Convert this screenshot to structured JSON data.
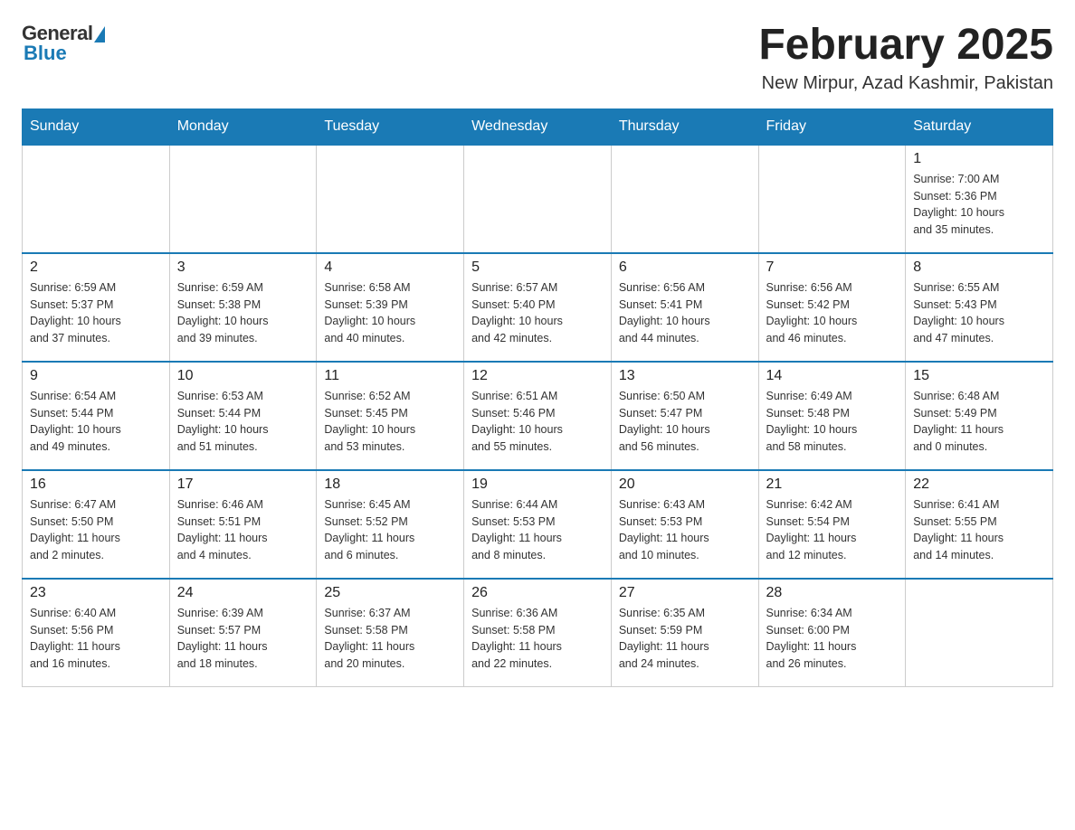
{
  "logo": {
    "general": "General",
    "blue": "Blue"
  },
  "title": "February 2025",
  "subtitle": "New Mirpur, Azad Kashmir, Pakistan",
  "weekdays": [
    "Sunday",
    "Monday",
    "Tuesday",
    "Wednesday",
    "Thursday",
    "Friday",
    "Saturday"
  ],
  "weeks": [
    [
      {
        "day": "",
        "info": ""
      },
      {
        "day": "",
        "info": ""
      },
      {
        "day": "",
        "info": ""
      },
      {
        "day": "",
        "info": ""
      },
      {
        "day": "",
        "info": ""
      },
      {
        "day": "",
        "info": ""
      },
      {
        "day": "1",
        "info": "Sunrise: 7:00 AM\nSunset: 5:36 PM\nDaylight: 10 hours\nand 35 minutes."
      }
    ],
    [
      {
        "day": "2",
        "info": "Sunrise: 6:59 AM\nSunset: 5:37 PM\nDaylight: 10 hours\nand 37 minutes."
      },
      {
        "day": "3",
        "info": "Sunrise: 6:59 AM\nSunset: 5:38 PM\nDaylight: 10 hours\nand 39 minutes."
      },
      {
        "day": "4",
        "info": "Sunrise: 6:58 AM\nSunset: 5:39 PM\nDaylight: 10 hours\nand 40 minutes."
      },
      {
        "day": "5",
        "info": "Sunrise: 6:57 AM\nSunset: 5:40 PM\nDaylight: 10 hours\nand 42 minutes."
      },
      {
        "day": "6",
        "info": "Sunrise: 6:56 AM\nSunset: 5:41 PM\nDaylight: 10 hours\nand 44 minutes."
      },
      {
        "day": "7",
        "info": "Sunrise: 6:56 AM\nSunset: 5:42 PM\nDaylight: 10 hours\nand 46 minutes."
      },
      {
        "day": "8",
        "info": "Sunrise: 6:55 AM\nSunset: 5:43 PM\nDaylight: 10 hours\nand 47 minutes."
      }
    ],
    [
      {
        "day": "9",
        "info": "Sunrise: 6:54 AM\nSunset: 5:44 PM\nDaylight: 10 hours\nand 49 minutes."
      },
      {
        "day": "10",
        "info": "Sunrise: 6:53 AM\nSunset: 5:44 PM\nDaylight: 10 hours\nand 51 minutes."
      },
      {
        "day": "11",
        "info": "Sunrise: 6:52 AM\nSunset: 5:45 PM\nDaylight: 10 hours\nand 53 minutes."
      },
      {
        "day": "12",
        "info": "Sunrise: 6:51 AM\nSunset: 5:46 PM\nDaylight: 10 hours\nand 55 minutes."
      },
      {
        "day": "13",
        "info": "Sunrise: 6:50 AM\nSunset: 5:47 PM\nDaylight: 10 hours\nand 56 minutes."
      },
      {
        "day": "14",
        "info": "Sunrise: 6:49 AM\nSunset: 5:48 PM\nDaylight: 10 hours\nand 58 minutes."
      },
      {
        "day": "15",
        "info": "Sunrise: 6:48 AM\nSunset: 5:49 PM\nDaylight: 11 hours\nand 0 minutes."
      }
    ],
    [
      {
        "day": "16",
        "info": "Sunrise: 6:47 AM\nSunset: 5:50 PM\nDaylight: 11 hours\nand 2 minutes."
      },
      {
        "day": "17",
        "info": "Sunrise: 6:46 AM\nSunset: 5:51 PM\nDaylight: 11 hours\nand 4 minutes."
      },
      {
        "day": "18",
        "info": "Sunrise: 6:45 AM\nSunset: 5:52 PM\nDaylight: 11 hours\nand 6 minutes."
      },
      {
        "day": "19",
        "info": "Sunrise: 6:44 AM\nSunset: 5:53 PM\nDaylight: 11 hours\nand 8 minutes."
      },
      {
        "day": "20",
        "info": "Sunrise: 6:43 AM\nSunset: 5:53 PM\nDaylight: 11 hours\nand 10 minutes."
      },
      {
        "day": "21",
        "info": "Sunrise: 6:42 AM\nSunset: 5:54 PM\nDaylight: 11 hours\nand 12 minutes."
      },
      {
        "day": "22",
        "info": "Sunrise: 6:41 AM\nSunset: 5:55 PM\nDaylight: 11 hours\nand 14 minutes."
      }
    ],
    [
      {
        "day": "23",
        "info": "Sunrise: 6:40 AM\nSunset: 5:56 PM\nDaylight: 11 hours\nand 16 minutes."
      },
      {
        "day": "24",
        "info": "Sunrise: 6:39 AM\nSunset: 5:57 PM\nDaylight: 11 hours\nand 18 minutes."
      },
      {
        "day": "25",
        "info": "Sunrise: 6:37 AM\nSunset: 5:58 PM\nDaylight: 11 hours\nand 20 minutes."
      },
      {
        "day": "26",
        "info": "Sunrise: 6:36 AM\nSunset: 5:58 PM\nDaylight: 11 hours\nand 22 minutes."
      },
      {
        "day": "27",
        "info": "Sunrise: 6:35 AM\nSunset: 5:59 PM\nDaylight: 11 hours\nand 24 minutes."
      },
      {
        "day": "28",
        "info": "Sunrise: 6:34 AM\nSunset: 6:00 PM\nDaylight: 11 hours\nand 26 minutes."
      },
      {
        "day": "",
        "info": ""
      }
    ]
  ]
}
